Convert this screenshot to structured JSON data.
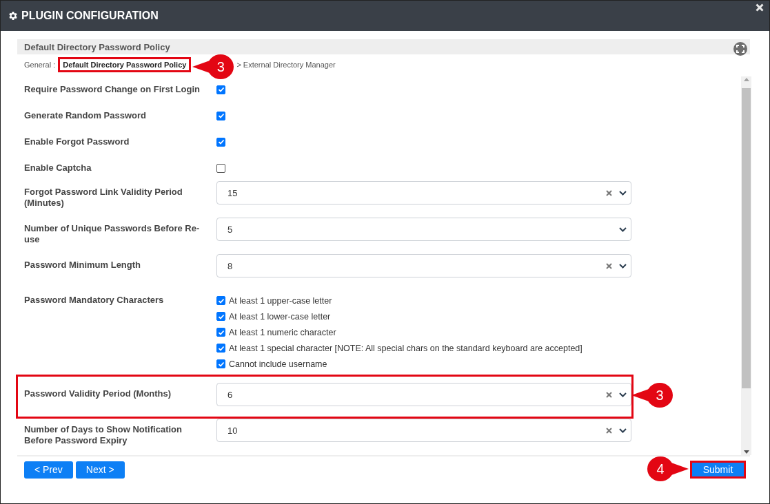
{
  "window": {
    "title": "PLUGIN CONFIGURATION"
  },
  "panel": {
    "title": "Default Directory Password Policy"
  },
  "breadcrumb": [
    {
      "label": "General :",
      "selected": false,
      "highlighted": false
    },
    {
      "label": "Default Directory Password Policy",
      "selected": true,
      "highlighted": true,
      "callout": "3"
    },
    {
      "label": "> External Directory Manager",
      "selected": false,
      "highlighted": false
    }
  ],
  "fields": [
    {
      "kind": "checkbox",
      "label": "Require Password Change on First Login",
      "checked": true
    },
    {
      "kind": "checkbox",
      "label": "Generate Random Password",
      "checked": true
    },
    {
      "kind": "checkbox",
      "label": "Enable Forgot Password",
      "checked": true
    },
    {
      "kind": "checkbox",
      "label": "Enable Captcha",
      "checked": false
    },
    {
      "kind": "select",
      "label": "Forgot Password Link Validity Period (Minutes)",
      "value": "15",
      "clearable": true
    },
    {
      "kind": "select",
      "label": "Number of Unique Passwords Before Re-use",
      "value": "5",
      "clearable": false
    },
    {
      "kind": "select",
      "label": "Password Minimum Length",
      "value": "8",
      "clearable": true
    },
    {
      "kind": "checklist",
      "label": "Password Mandatory Characters",
      "options": [
        {
          "label": "At least 1 upper-case letter",
          "checked": true
        },
        {
          "label": "At least 1 lower-case letter",
          "checked": true
        },
        {
          "label": "At least 1 numeric character",
          "checked": true
        },
        {
          "label": "At least 1 special character [NOTE: All special chars on the standard keyboard are accepted]",
          "checked": true
        },
        {
          "label": "Cannot include username",
          "checked": true
        }
      ]
    },
    {
      "kind": "select",
      "label": "Password Validity Period (Months)",
      "value": "6",
      "clearable": true,
      "highlighted": true,
      "callout": "3"
    },
    {
      "kind": "select",
      "label": "Number of Days to Show Notification Before Password Expiry",
      "value": "10",
      "clearable": true
    }
  ],
  "footer": {
    "prev": "< Prev",
    "next": "Next >",
    "submit": {
      "label": "Submit",
      "highlighted": true,
      "callout": "4"
    }
  }
}
